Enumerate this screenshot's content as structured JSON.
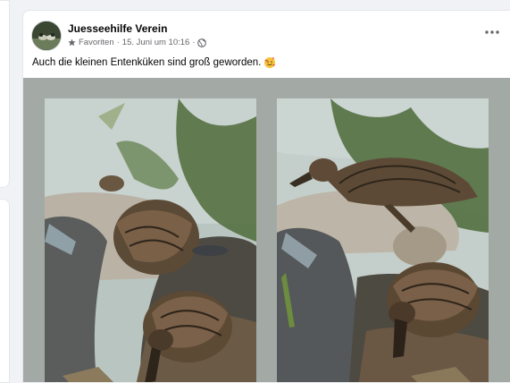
{
  "post": {
    "author": "Juesseehilfe Verein",
    "audience": "Favoriten",
    "separator": "·",
    "timestamp": "15. Juni um 10:16",
    "text": "Auch die kleinen Entenküken sind groß geworden.",
    "emoji": "smiling-face-with-hearts-emoji"
  },
  "icons": {
    "audience": "star-icon",
    "privacy": "globe-icon",
    "more": "more-options-icon"
  },
  "media": {
    "photos": [
      {
        "subject": "two mallard ducks on a stone beside water"
      },
      {
        "subject": "two mallard ducks on rocks beside water"
      }
    ]
  },
  "colors": {
    "card": "#ffffff",
    "page_background": "#f0f2f5",
    "media_background": "#a3aaa6",
    "secondary_text": "#65676b",
    "primary_text": "#050505"
  }
}
